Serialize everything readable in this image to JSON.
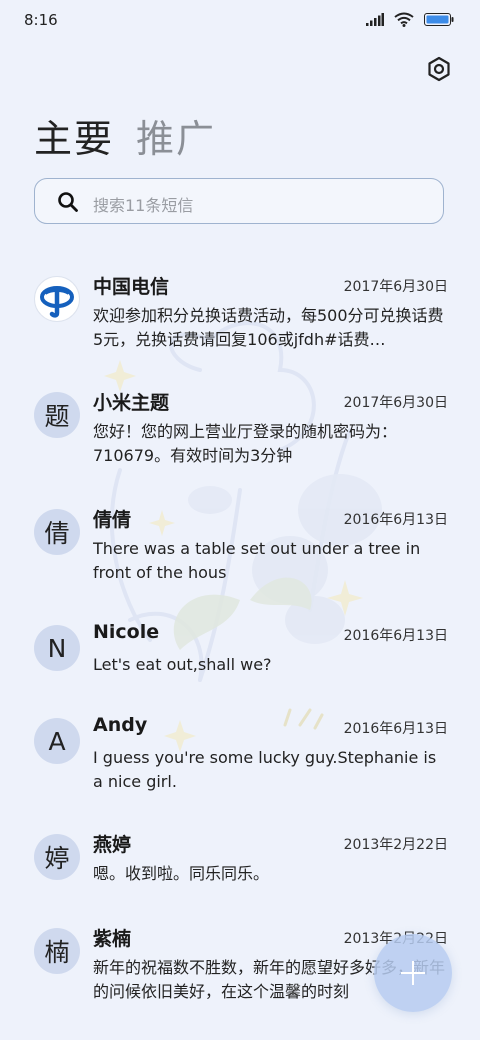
{
  "status_bar": {
    "time": "8:16",
    "icons": [
      "signal-icon",
      "wifi-icon",
      "battery-icon"
    ]
  },
  "header": {
    "settings_icon": "gear-icon",
    "tabs": [
      {
        "label": "主要",
        "active": true
      },
      {
        "label": "推广",
        "active": false
      }
    ]
  },
  "search": {
    "icon": "search-icon",
    "placeholder": "搜索11条短信"
  },
  "messages": [
    {
      "avatar_text": "",
      "avatar_type": "china-telecom-logo",
      "name": "中国电信",
      "date": "2017年6月30日",
      "preview": "欢迎参加积分兑换话费活动，每500分可兑换话费5元，兑换话费请回复106或jfdh#话费…"
    },
    {
      "avatar_text": "题",
      "name": "小米主题",
      "date": "2017年6月30日",
      "preview": "您好！您的网上营业厅登录的随机密码为：710679。有效时间为3分钟"
    },
    {
      "avatar_text": "倩",
      "name": "倩倩",
      "date": "2016年6月13日",
      "preview": "There was a table set out under a tree in front of the hous"
    },
    {
      "avatar_text": "N",
      "name": "Nicole",
      "date": "2016年6月13日",
      "preview": "Let's eat out,shall we?"
    },
    {
      "avatar_text": "A",
      "name": "Andy",
      "date": "2016年6月13日",
      "preview": "I guess you're some lucky guy.Stephanie is a nice girl."
    },
    {
      "avatar_text": "婷",
      "name": "燕婷",
      "date": "2013年2月22日",
      "preview": "嗯。收到啦。同乐同乐。"
    },
    {
      "avatar_text": "楠",
      "name": "紫楠",
      "date": "2013年2月22日",
      "preview": "新年的祝福数不胜数，新年的愿望好多好多，新年的问候依旧美好，在这个温馨的时刻"
    }
  ],
  "fab": {
    "icon": "plus-icon"
  },
  "colors": {
    "background": "#eef2fb",
    "avatar_bg": "#cfd9ee",
    "fab_bg": "#b6cbf0",
    "telecom_blue": "#1560bd"
  }
}
